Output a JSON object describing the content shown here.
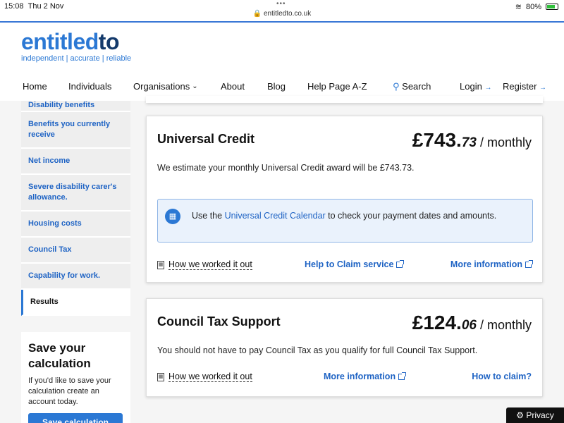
{
  "status_bar": {
    "time": "15:08",
    "date": "Thu 2 Nov",
    "dots": "•••",
    "url": "🔒 entitledto.co.uk",
    "battery": "80%",
    "battery_level": 0.8
  },
  "header": {
    "logo_a": "entitled",
    "logo_b": "to",
    "tagline": "independent | accurate | reliable"
  },
  "nav": {
    "home": "Home",
    "individuals": "Individuals",
    "organisations": "Organisations",
    "about": "About",
    "blog": "Blog",
    "help": "Help Page A-Z",
    "search": "Search",
    "login": "Login",
    "register": "Register",
    "arrow": "→"
  },
  "sidebar": {
    "items": [
      {
        "label": "Disability benefits"
      },
      {
        "label": "Benefits you currently receive"
      },
      {
        "label": "Net income"
      },
      {
        "label": "Severe disability carer's allowance."
      },
      {
        "label": "Housing costs"
      },
      {
        "label": "Council Tax"
      },
      {
        "label": "Capability for work."
      },
      {
        "label": "Results"
      }
    ],
    "save_title": "Save your calculation",
    "save_text": "If you'd like to save your calculation create an account today.",
    "save_button": "Save calculation"
  },
  "cards": [
    {
      "title": "Universal Credit",
      "amount_main": "£743.",
      "amount_dec": "73",
      "period": " / monthly",
      "description": "We estimate your monthly Universal Credit award will be £743.73.",
      "info_prefix": "Use the ",
      "info_link": "Universal Credit Calendar",
      "info_suffix": " to check your payment dates and amounts.",
      "worked_out": "How we worked it out",
      "link1": "Help to Claim service",
      "link2": "More information"
    },
    {
      "title": "Council Tax Support",
      "amount_main": "£124.",
      "amount_dec": "06",
      "period": " / monthly",
      "description": "You should not have to pay Council Tax as you qualify for full Council Tax Support.",
      "worked_out": "How we worked it out",
      "link1": "More information",
      "link2": "How to claim?"
    }
  ],
  "privacy": "⚙ Privacy",
  "colors": {
    "brand_blue": "#2b78d4",
    "brand_dark": "#143a6b",
    "link": "#1e63c4"
  }
}
